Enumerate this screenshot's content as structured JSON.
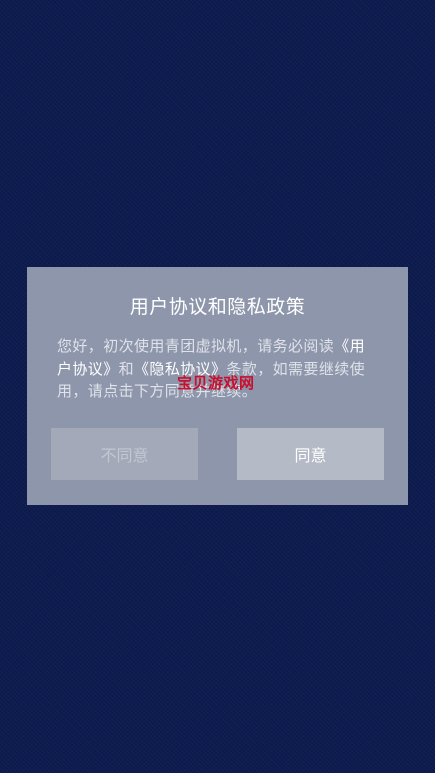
{
  "dialog": {
    "title": "用户协议和隐私政策",
    "body": {
      "part1": "您好，初次使用青团虚拟机，请务必阅读",
      "user_agreement_link": "《用户协议》",
      "part2": "和",
      "privacy_link": "《隐私协议》",
      "part3": "条款，如需要继续使用，请点击下方同意并继续。"
    },
    "watermark": "宝贝游戏网",
    "disagree_label": "不同意",
    "agree_label": "同意"
  },
  "colors": {
    "background": "#0d1b4e",
    "dialog_bg": "#8e96ab",
    "disagree_bg": "#a3a9b9",
    "agree_bg": "#b5bac7",
    "watermark": "#c8102e"
  }
}
